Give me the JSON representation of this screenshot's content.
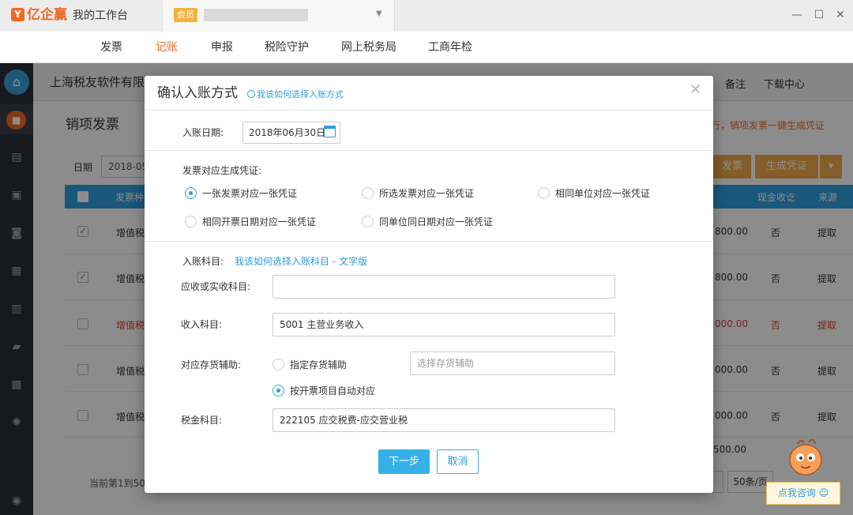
{
  "app": {
    "logo_text": "亿企赢",
    "workbench_title": "我的工作台",
    "member_badge": "会员"
  },
  "nav": {
    "items": [
      {
        "label": "发票",
        "active": false
      },
      {
        "label": "记账",
        "active": true
      },
      {
        "label": "申报",
        "active": false
      },
      {
        "label": "税险守护",
        "active": false
      },
      {
        "label": "网上税务局",
        "active": false
      },
      {
        "label": "工商年检",
        "active": false
      }
    ]
  },
  "background": {
    "company_name": "上海税友软件有限",
    "note_label": "备注",
    "download_label": "下载中心",
    "page_title": "销项发票",
    "hint_text": "行，销项发票一键生成凭证",
    "date_label": "日期",
    "date_value": "2018-05",
    "btn_invoice": "发票",
    "btn_generate": "生成凭证",
    "table_headers": {
      "type": "发票种",
      "cash": "现金收讫",
      "source": "来源"
    },
    "rows": [
      {
        "checked": true,
        "type": "增值税",
        "amount": "800.00",
        "cash": "否",
        "source": "提取",
        "red": false
      },
      {
        "checked": true,
        "type": "增值税",
        "amount": "800.00",
        "cash": "否",
        "source": "提取",
        "red": false
      },
      {
        "checked": false,
        "type": "增值税",
        "amount": "000.00",
        "cash": "否",
        "source": "提取",
        "red": true
      },
      {
        "checked": false,
        "type": "增值税",
        "amount": "000.00",
        "cash": "否",
        "source": "提取",
        "red": false
      },
      {
        "checked": false,
        "type": "增值税",
        "amount": "000.00",
        "cash": "否",
        "source": "提取",
        "red": false
      }
    ],
    "total_amount": "500.00",
    "pager_text": "当前第1到50",
    "page_size": "50条/页"
  },
  "modal": {
    "title": "确认入账方式",
    "help_link": "我该如何选择入账方式",
    "date_label": "入账日期:",
    "date_value": "2018年06月30日",
    "voucher_label": "发票对应生成凭证:",
    "voucher_options": [
      {
        "label": "一张发票对应一张凭证",
        "selected": true
      },
      {
        "label": "所选发票对应一张凭证",
        "selected": false
      },
      {
        "label": "相同单位对应一张凭证",
        "selected": false
      },
      {
        "label": "相同开票日期对应一张凭证",
        "selected": false
      },
      {
        "label": "同单位同日期对应一张凭证",
        "selected": false
      }
    ],
    "account_label": "入账科目:",
    "account_help_link": "我该如何选择入账科目 - 文字版",
    "receivable_label": "应收或实收科目:",
    "receivable_value": "",
    "income_label": "收入科目:",
    "income_value": "5001 主营业务收入",
    "inventory_label": "对应存货辅助:",
    "inventory_option_specify": "指定存货辅助",
    "inventory_placeholder": "选择存货辅助",
    "inventory_option_auto": "按开票项目自动对应",
    "tax_label": "税金科目:",
    "tax_value": "222105 应交税费-应交营业税",
    "next_button": "下一步",
    "cancel_button": "取消"
  },
  "consult": {
    "label": "点我咨询"
  }
}
